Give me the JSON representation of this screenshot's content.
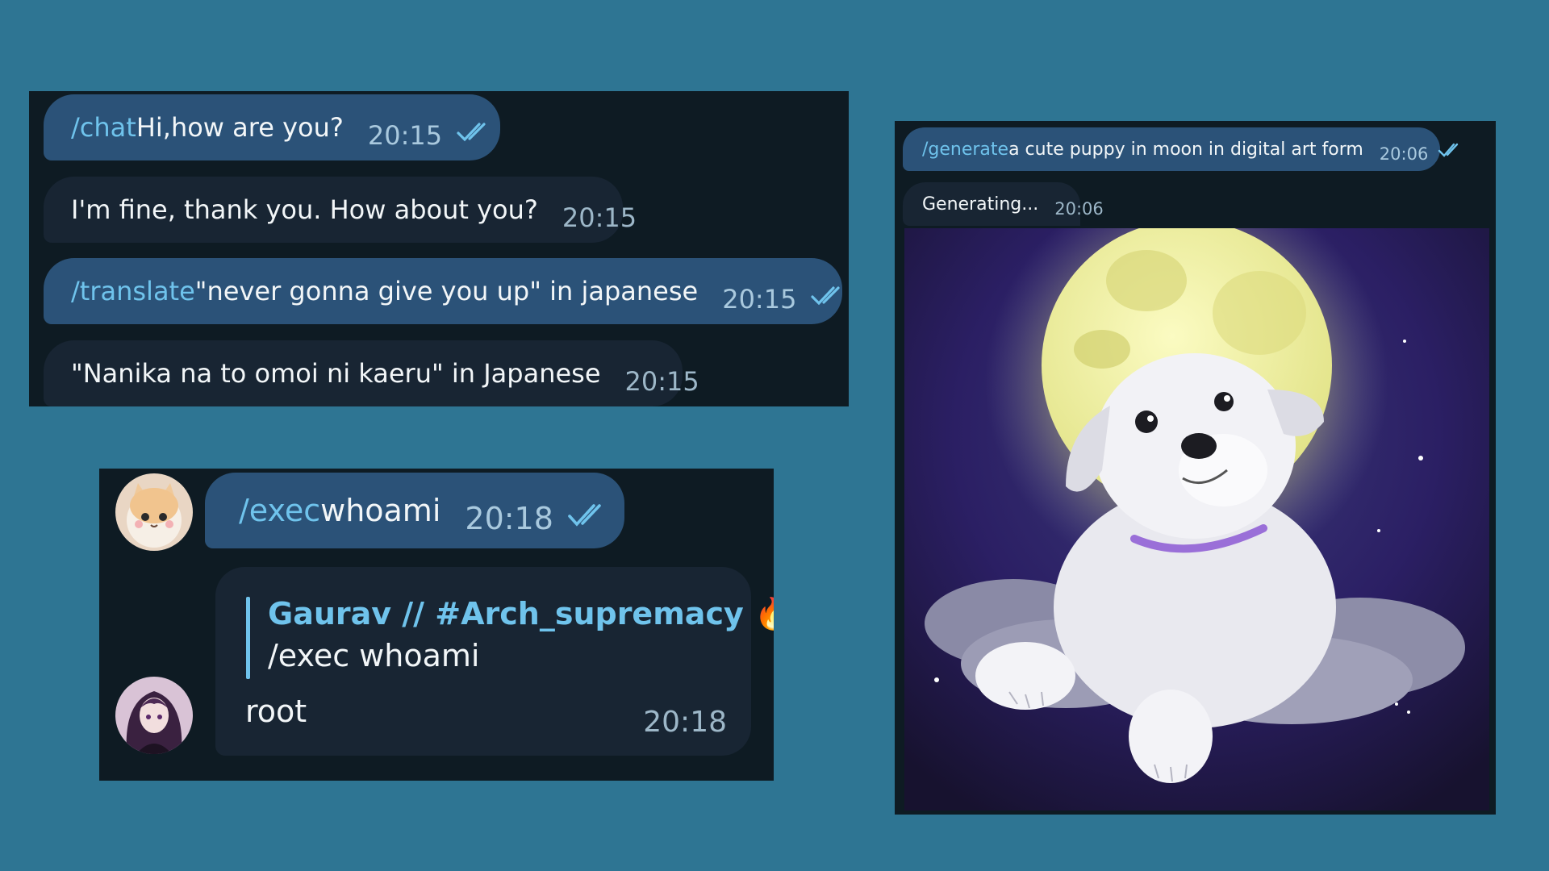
{
  "chat": {
    "messages": [
      {
        "cmd": "/chat",
        "text": " Hi,how are you?",
        "time": "20:15"
      },
      {
        "text": "I'm fine, thank you. How about you?",
        "time": "20:15"
      },
      {
        "cmd": "/translate",
        "text": " \"never gonna give you up\" in japanese",
        "time": "20:15"
      },
      {
        "text": "\"Nanika na to omoi ni kaeru\" in Japanese",
        "time": "20:15"
      }
    ]
  },
  "exec": {
    "cmd": "/exec",
    "text": " whoami",
    "time": "20:18",
    "reply": {
      "name": "Gaurav // #Arch_supremacy",
      "emoji": "🔥",
      "quoted": "/exec whoami",
      "text": "root",
      "time": "20:18"
    }
  },
  "generate": {
    "cmd": "/generate",
    "text": " a cute puppy in moon in digital art form",
    "time": "20:06",
    "status": "Generating...",
    "status_time": "20:06"
  },
  "colors": {
    "background": "#2e7593",
    "panel": "#0e1b23",
    "outgoing_bubble": "#2b5278",
    "incoming_bubble": "#182533",
    "command": "#6fc3ec"
  },
  "icons": [
    "double-check-icon",
    "cat-avatar",
    "anime-avatar",
    "fire-emoji",
    "puppy-moon-image"
  ]
}
